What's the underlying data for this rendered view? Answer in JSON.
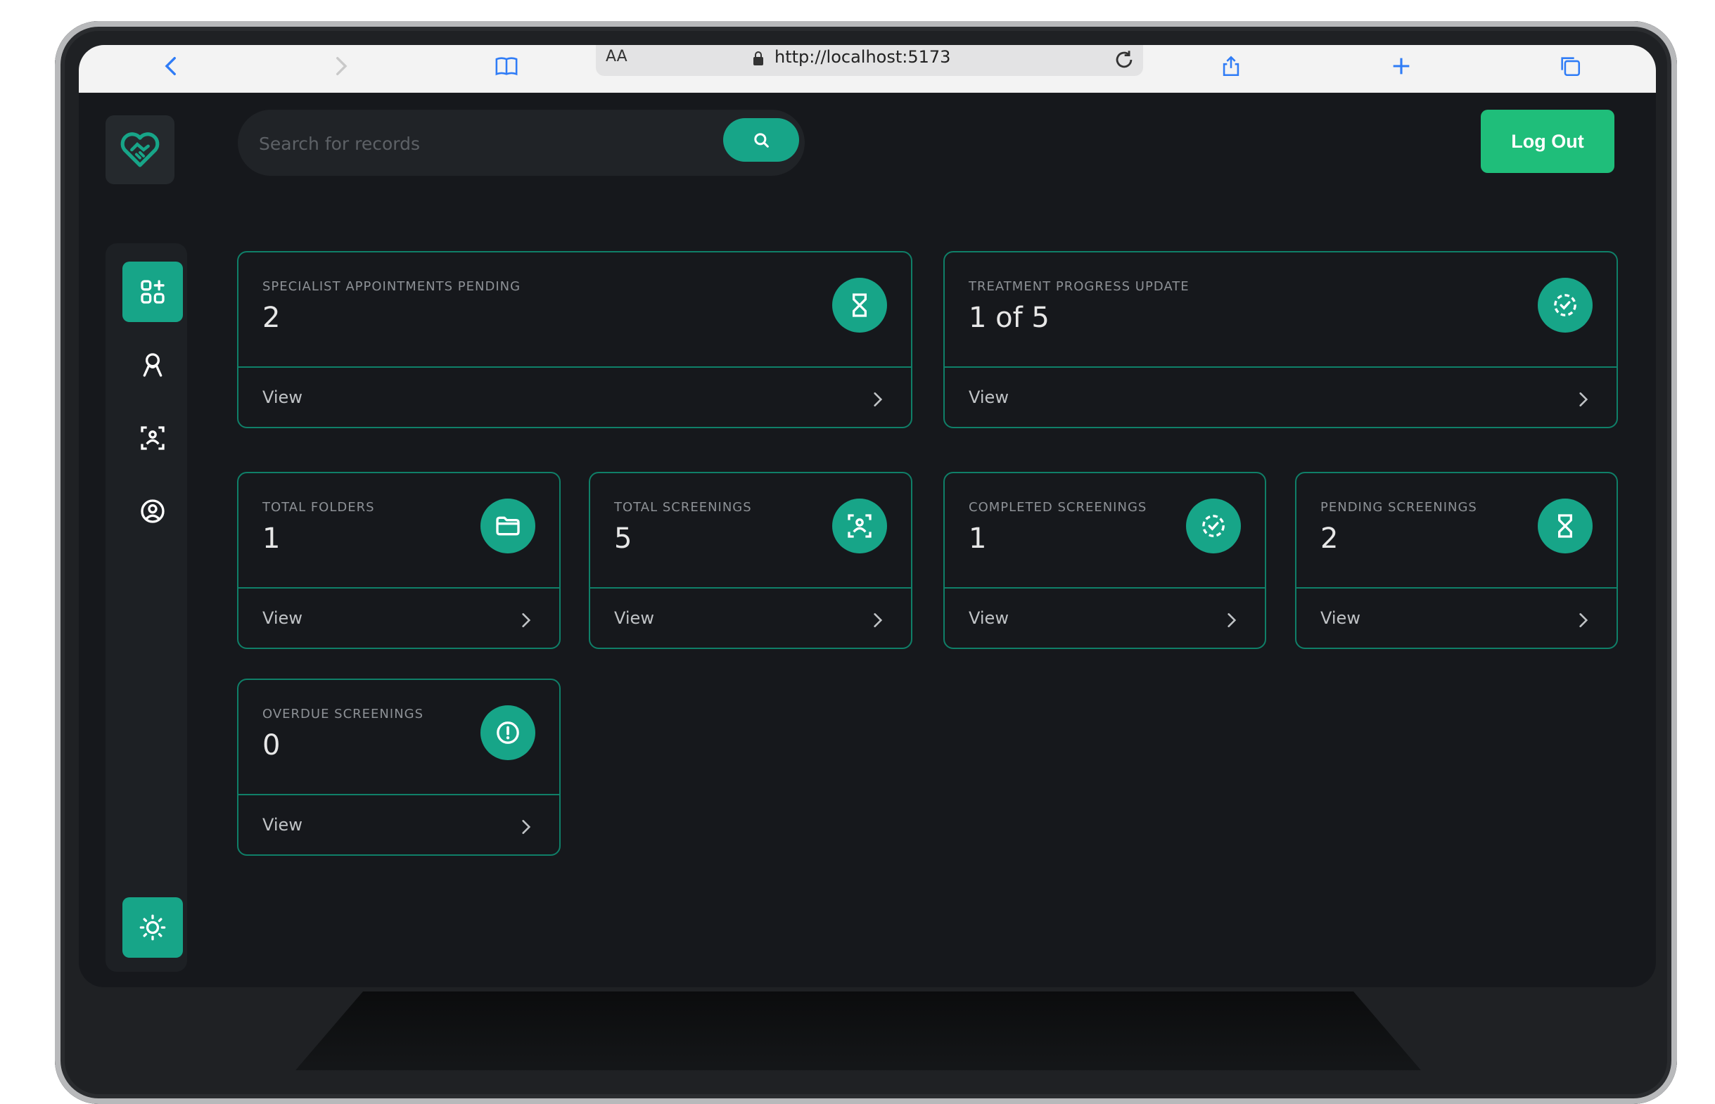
{
  "browser": {
    "url": "http://localhost:5173",
    "text_size_label": "AA"
  },
  "search": {
    "placeholder": "Search for records"
  },
  "header": {
    "logout_label": "Log Out"
  },
  "colors": {
    "accent": "#17a588",
    "logout": "#1fbe7a",
    "card_border": "#0f7f68",
    "background": "#16181c"
  },
  "sidebar": {
    "items": [
      {
        "name": "dashboard",
        "icon": "dashboard-grid-icon",
        "active": true
      },
      {
        "name": "ribbon",
        "icon": "ribbon-icon",
        "active": false
      },
      {
        "name": "screenings",
        "icon": "scan-person-icon",
        "active": false
      },
      {
        "name": "profile",
        "icon": "user-circle-icon",
        "active": false
      }
    ],
    "theme_toggle_icon": "sun-icon"
  },
  "cards": [
    {
      "label": "SPECIALIST APPOINTMENTS PENDING",
      "value": "2",
      "icon": "hourglass-icon",
      "link": "View"
    },
    {
      "label": "TREATMENT PROGRESS UPDATE",
      "value": "1 of 5",
      "icon": "progress-check-icon",
      "link": "View"
    },
    {
      "label": "TOTAL FOLDERS",
      "value": "1",
      "icon": "folder-icon",
      "link": "View"
    },
    {
      "label": "TOTAL SCREENINGS",
      "value": "5",
      "icon": "scan-person-icon",
      "link": "View"
    },
    {
      "label": "COMPLETED SCREENINGS",
      "value": "1",
      "icon": "progress-check-icon",
      "link": "View"
    },
    {
      "label": "PENDING SCREENINGS",
      "value": "2",
      "icon": "hourglass-icon",
      "link": "View"
    },
    {
      "label": "OVERDUE SCREENINGS",
      "value": "0",
      "icon": "alert-circle-icon",
      "link": "View"
    }
  ]
}
